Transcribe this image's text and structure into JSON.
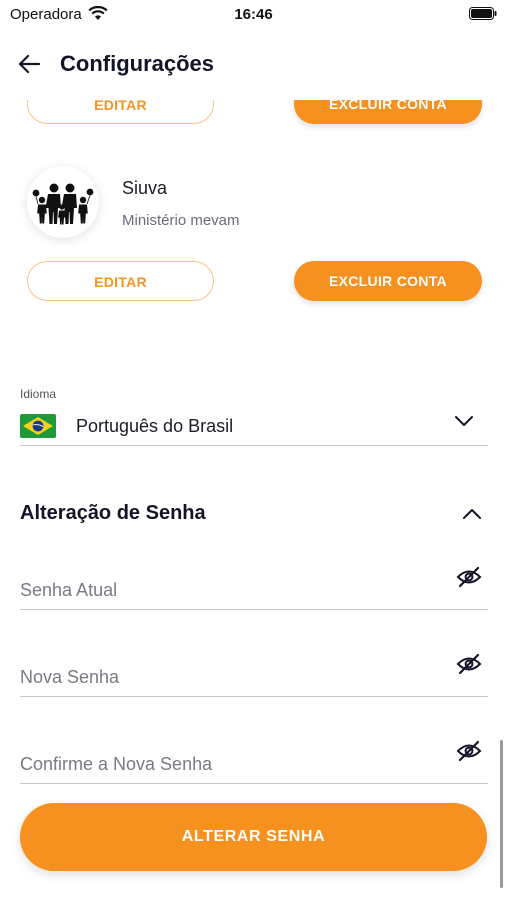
{
  "status_bar": {
    "carrier": "Operadora",
    "time": "16:46"
  },
  "header": {
    "back_icon": "arrow-left-icon",
    "title": "Configurações"
  },
  "accounts": [
    {
      "edit_label": "EDITAR",
      "delete_label": "EXCLUIR CONTA"
    },
    {
      "name": "Siuva",
      "subtitle": "Ministério mevam",
      "avatar_icon": "family-icon",
      "edit_label": "EDITAR",
      "delete_label": "EXCLUIR CONTA"
    }
  ],
  "language": {
    "label": "Idioma",
    "flag_icon": "brazil-flag-icon",
    "value": "Português do Brasil"
  },
  "password_change": {
    "title": "Alteração de Senha",
    "fields": [
      {
        "placeholder": "Senha Atual",
        "value": ""
      },
      {
        "placeholder": "Nova Senha",
        "value": ""
      },
      {
        "placeholder": "Confirme a Nova Senha",
        "value": ""
      }
    ],
    "submit_label": "ALTERAR SENHA"
  },
  "colors": {
    "accent": "#f6901e",
    "outline": "#f7c58a",
    "divider": "#c8c8cc"
  }
}
